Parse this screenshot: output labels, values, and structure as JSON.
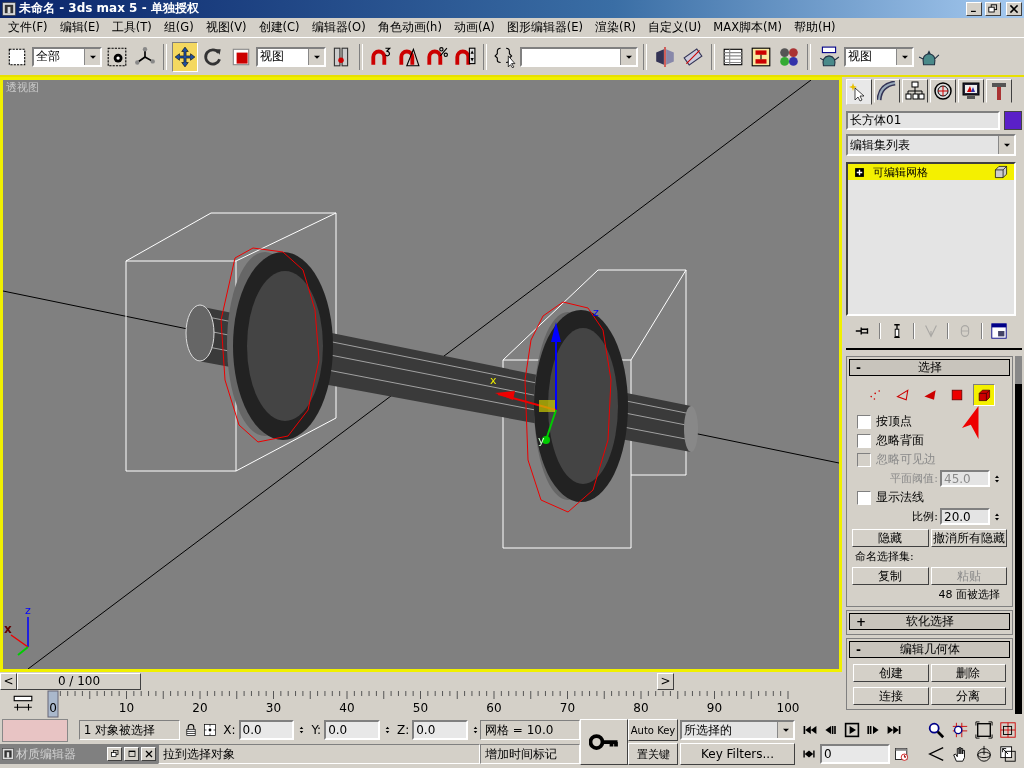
{
  "window": {
    "title": "未命名 - 3ds max 5 - 单独授权"
  },
  "menu": [
    "文件(F)",
    "编辑(E)",
    "工具(T)",
    "组(G)",
    "视图(V)",
    "创建(C)",
    "编辑器(O)",
    "角色动画(h)",
    "动画(A)",
    "图形编辑器(E)",
    "渲染(R)",
    "自定义(U)",
    "MAX脚本(M)",
    "帮助(H)"
  ],
  "toolbar": [
    {
      "kind": "button",
      "selected": false
    },
    {
      "kind": "dropdown",
      "value": "全部"
    },
    {
      "kind": "button",
      "selected": false
    },
    {
      "kind": "button",
      "selected": false
    },
    {
      "kind": "separator"
    },
    {
      "kind": "button",
      "selected": true
    },
    {
      "kind": "button",
      "selected": false
    },
    {
      "kind": "button",
      "selected": false
    },
    {
      "kind": "dropdown",
      "value": "视图"
    },
    {
      "kind": "button",
      "selected": false
    },
    {
      "kind": "separator"
    },
    {
      "kind": "button",
      "selected": false
    },
    {
      "kind": "button",
      "selected": false
    },
    {
      "kind": "button",
      "selected": false
    },
    {
      "kind": "button",
      "selected": false
    },
    {
      "kind": "separator"
    },
    {
      "kind": "button",
      "selected": false
    },
    {
      "kind": "dropdown"
    },
    {
      "kind": "separator"
    },
    {
      "kind": "button",
      "selected": false
    },
    {
      "kind": "button",
      "selected": false
    },
    {
      "kind": "separator"
    },
    {
      "kind": "button",
      "selected": false
    },
    {
      "kind": "button",
      "selected": false
    },
    {
      "kind": "button",
      "selected": false
    },
    {
      "kind": "separator"
    },
    {
      "kind": "button",
      "selected": false
    },
    {
      "kind": "dropdown",
      "value": "视图"
    },
    {
      "kind": "button",
      "selected": false
    }
  ],
  "viewport": {
    "label": "透视图",
    "active": true,
    "gizmo_labels": [
      "z",
      "x",
      "y"
    ],
    "tripod_labels": [
      "z",
      "x"
    ]
  },
  "time_slider": {
    "previous": "<",
    "position": "0 / 100",
    "level": 0,
    "next": ">"
  },
  "track_bar": {
    "frames": [
      "0",
      "10",
      "20",
      "30",
      "40",
      "50",
      "60",
      "70",
      "80",
      "90",
      "100"
    ]
  },
  "command_panel": {
    "tabs": [
      {
        "selected": true
      },
      {
        "selected": false
      },
      {
        "selected": false
      },
      {
        "selected": false
      },
      {
        "selected": false
      },
      {
        "selected": false
      }
    ],
    "object_name": "长方体01",
    "modifier_list": "编辑集列表",
    "stack": [
      {
        "label": "可编辑网格",
        "selected": true,
        "expanded": false
      }
    ],
    "stack_tools": [
      {
        "disabled": false
      },
      {
        "disabled": false
      },
      {
        "disabled": true
      },
      {
        "disabled": true
      },
      {
        "disabled": false
      }
    ],
    "rollouts": [
      {
        "sign": "-",
        "title": "选择",
        "levels": [
          {
            "selected": false
          },
          {
            "selected": false
          },
          {
            "selected": false
          },
          {
            "selected": false
          },
          {
            "selected": true
          }
        ],
        "options": [
          {
            "kind": "checkbox",
            "label": "按顶点",
            "checked": false,
            "disabled": false
          },
          {
            "kind": "checkbox",
            "label": "忽略背面",
            "checked": false,
            "disabled": false
          },
          {
            "kind": "checkbox",
            "label": "忽略可见边",
            "checked": false,
            "disabled": true
          },
          {
            "kind": "spinner",
            "label": "平面阈值:",
            "value": "45.0",
            "disabled": true
          },
          {
            "kind": "checkbox",
            "label": "显示法线",
            "checked": false,
            "disabled": false
          },
          {
            "kind": "spinner",
            "label": "比例:",
            "value": "20.0",
            "disabled": false
          },
          {
            "kind": "buttons",
            "buttons": [
              {
                "label": "隐藏",
                "disabled": false
              },
              {
                "label": "撤消所有隐藏",
                "disabled": false
              }
            ]
          },
          {
            "kind": "label",
            "text": "命名选择集:"
          },
          {
            "kind": "buttons",
            "buttons": [
              {
                "label": "复制",
                "disabled": false
              },
              {
                "label": "粘贴",
                "disabled": true
              }
            ]
          },
          {
            "kind": "note",
            "text": "48 面被选择"
          }
        ]
      },
      {
        "sign": "+",
        "title": "软化选择"
      },
      {
        "sign": "-",
        "title": "编辑几何体",
        "buttons": [
          {
            "label": "创建",
            "disabled": false
          },
          {
            "label": "删除",
            "disabled": false
          },
          {
            "label": "连接",
            "disabled": false
          },
          {
            "label": "分离",
            "disabled": false
          }
        ]
      }
    ]
  },
  "status": {
    "selection": "1 对象被选择",
    "coordinates": [
      {
        "axis": "X:",
        "value": "0.0"
      },
      {
        "axis": "Y:",
        "value": "0.0"
      },
      {
        "axis": "Z:",
        "value": "0.0"
      }
    ],
    "grid": "网格 = 10.0",
    "auto_key": {
      "label": "Auto Key",
      "on": false
    },
    "key_set": "所选择的",
    "prompt": "拉到选择对象",
    "time_tag": "增加时间标记",
    "set_key": "置关键",
    "key_filters": "Key Filters...",
    "frame": "0",
    "material_editor": "材质编辑器"
  }
}
